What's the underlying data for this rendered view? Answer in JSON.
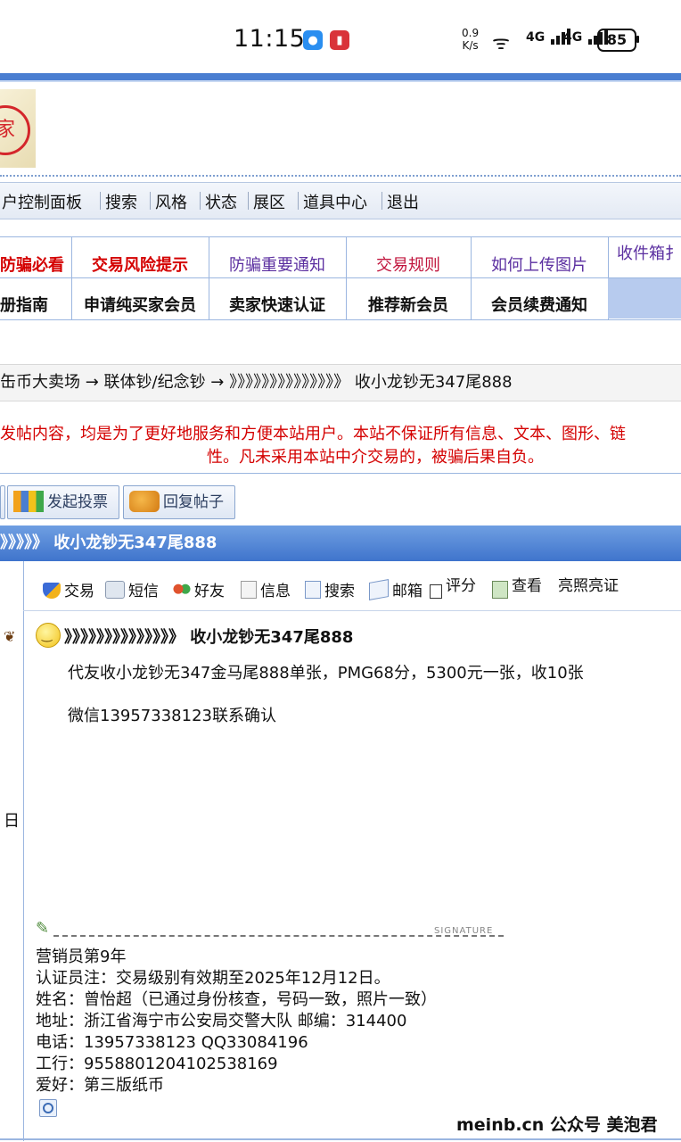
{
  "status_bar": {
    "time": "11:15",
    "net_speed_value": "0.9",
    "net_speed_unit": "K/s",
    "signal1_label": "4G",
    "signal2_label": "4G",
    "battery": "85"
  },
  "nav": {
    "items": [
      "户控制面板",
      "搜索",
      "风格",
      "状态",
      "展区",
      "道具中心",
      "退出"
    ]
  },
  "notice_table": {
    "row1": [
      "防骗必看",
      "交易风险提示",
      "防骗重要通知",
      "交易规则",
      "如何上传图片",
      "收件箱扌"
    ],
    "row2": [
      "册指南",
      "申请纯买家会员",
      "卖家快速认证",
      "推荐新会员",
      "会员续费通知"
    ]
  },
  "breadcrumb": "缶币大卖场 → 联体钞/纪念钞 → 》》》》》》》》》》》》》》 收小龙钞无347尾888",
  "disclaimer": {
    "line1": "发帖内容，均是为了更好地服务和方便本站用户。本站不保证所有信息、文本、图形、链",
    "line2": "性。凡未采用本站中介交易的，被骗后果自负。"
  },
  "post_buttons": [
    "发起投票",
    "回复帖子"
  ],
  "thread_title_bar": "》》》》》 收小龙钞无347尾888",
  "toolbar": [
    "交易",
    "短信",
    "好友",
    "信息",
    "搜索",
    "邮箱",
    "评分",
    "查看",
    "亮照亮证"
  ],
  "post": {
    "title": "》》》》》》》》》》》》》》 收小龙钞无347尾888",
    "body_line1": "代友收小龙钞无347金马尾888单张，PMG68分，5300元一张，收10张",
    "body_line2": "微信13957338123联系确认"
  },
  "left_column": {
    "date_fragment": "日"
  },
  "signature": {
    "label": "SIGNATURE",
    "lines": [
      "营销员第9年",
      "认证员注：交易级别有效期至2025年12月12日。",
      "姓名：曾怡超（已通过身份核查，号码一致，照片一致）",
      "地址：浙江省海宁市公安局交警大队 邮编：314400",
      "电话：13957338123  QQ33084196",
      "工行：9558801204102538169",
      "爱好：第三版纸币"
    ]
  },
  "watermark": "meinb.cn  公众号 美泡君",
  "colors": {
    "header_blue": "#4a7ed1",
    "notice_red": "#d40000",
    "link_purple": "#5b2fa0"
  }
}
